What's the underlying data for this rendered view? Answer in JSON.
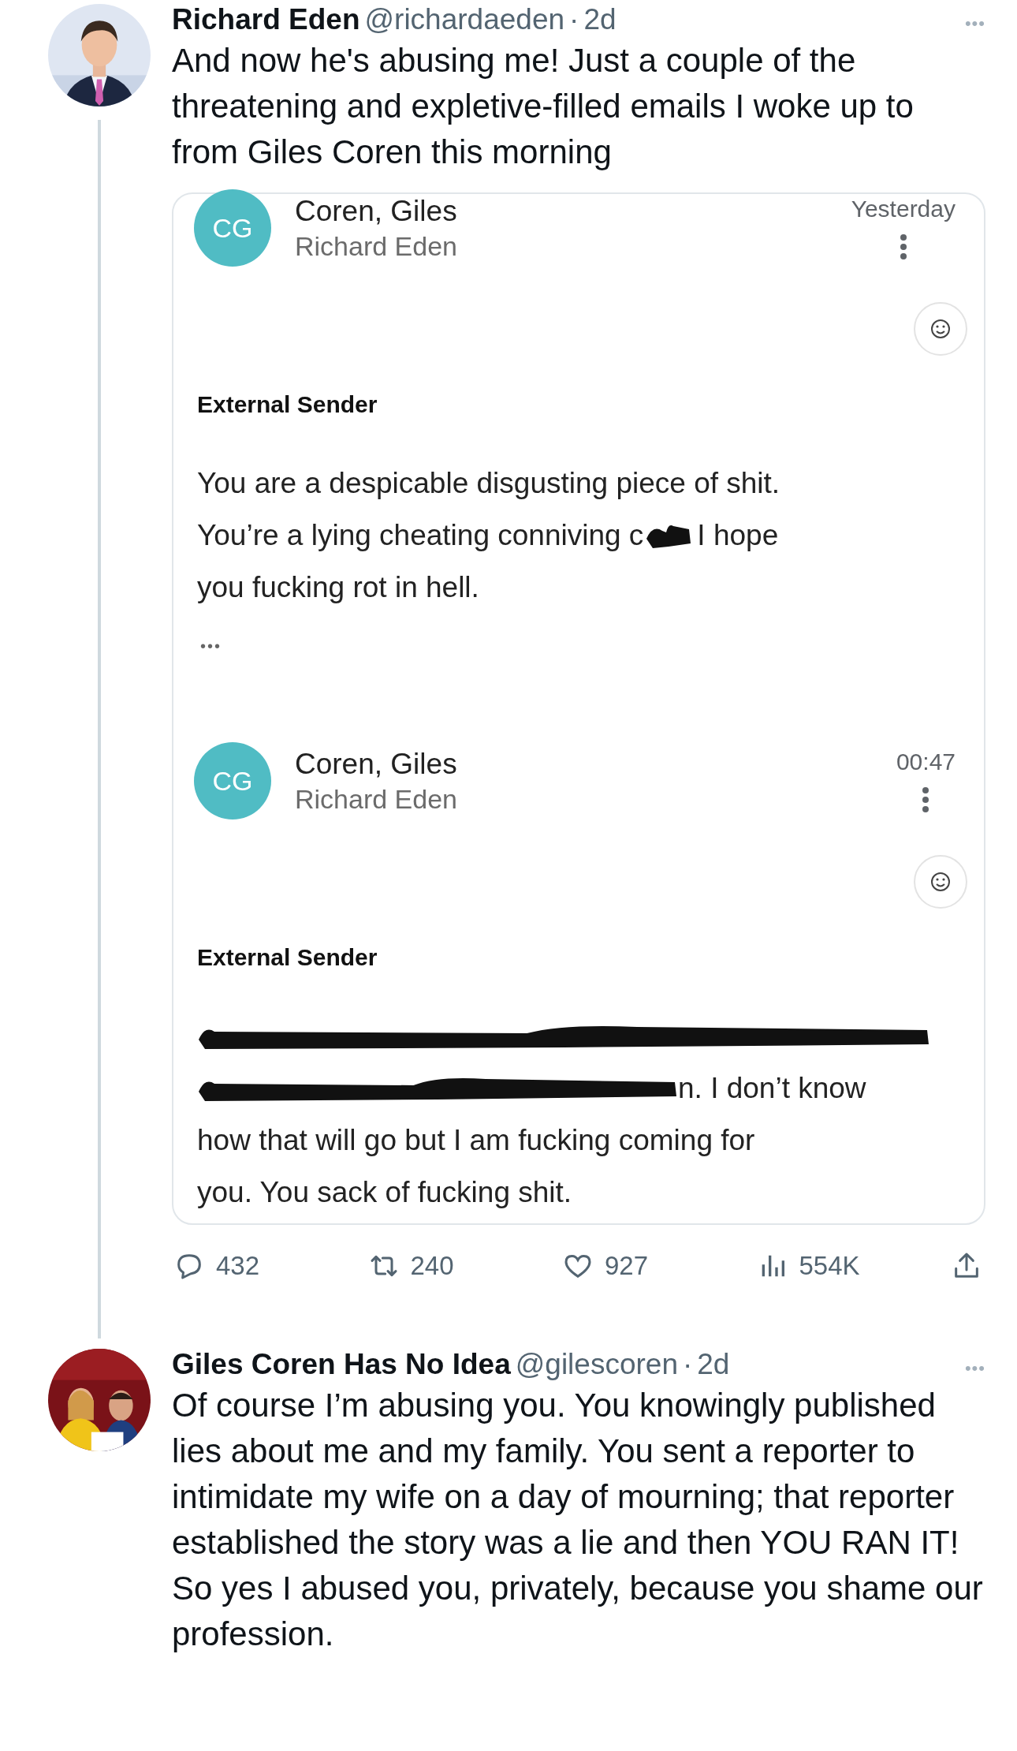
{
  "tweets": [
    {
      "name": "Richard Eden",
      "handle": "@richardaeden",
      "separator": "·",
      "time": "2d",
      "more": "•••",
      "text": "And now he's abusing me! Just a couple of the threatening and expletive-filled emails I woke up to from Giles Coren this morning",
      "thread_line": true,
      "embedded_screenshot": {
        "emails": [
          {
            "initials": "CG",
            "sender": "Coren, Giles",
            "recipient": "Richard Eden",
            "time": "Yesterday",
            "label": "External Sender",
            "body": [
              [
                {
                  "kind": "text",
                  "text": "You are a despicable disgusting piece of shit."
                }
              ],
              [
                {
                  "kind": "text",
                  "text": "You’re a lying cheating conniving c"
                },
                {
                  "kind": "redaction"
                },
                {
                  "kind": "text",
                  "text": "I hope"
                }
              ],
              [
                {
                  "kind": "text",
                  "text": "you fucking rot in hell."
                }
              ]
            ],
            "trimmed": "•••"
          },
          {
            "initials": "CG",
            "sender": "Coren, Giles",
            "recipient": "Richard Eden",
            "time": "00:47",
            "label": "External Sender",
            "body": [
              [
                {
                  "kind": "redaction"
                }
              ],
              [
                {
                  "kind": "redaction"
                },
                {
                  "kind": "text",
                  "text": "n. I don’t know"
                }
              ],
              [
                {
                  "kind": "text",
                  "text": "how that will go but I am fucking coming for"
                }
              ],
              [
                {
                  "kind": "text",
                  "text": "you. You sack of fucking shit."
                }
              ]
            ]
          }
        ]
      },
      "actions": [
        {
          "kind": "reply",
          "count": "432"
        },
        {
          "kind": "retweet",
          "count": "240"
        },
        {
          "kind": "like",
          "count": "927"
        },
        {
          "kind": "views",
          "count": "554K"
        },
        {
          "kind": "share"
        }
      ]
    },
    {
      "name": "Giles Coren Has No Idea",
      "handle": "@gilescoren",
      "separator": "·",
      "time": "2d",
      "more": "•••",
      "text": "Of course I’m abusing you. You knowingly published lies about me and my family. You sent a reporter to intimidate my wife on a day of mourning; that reporter established the story was a lie and then YOU RAN IT! So yes I abused you, privately, because you shame our profession.",
      "thread_line": false
    }
  ]
}
